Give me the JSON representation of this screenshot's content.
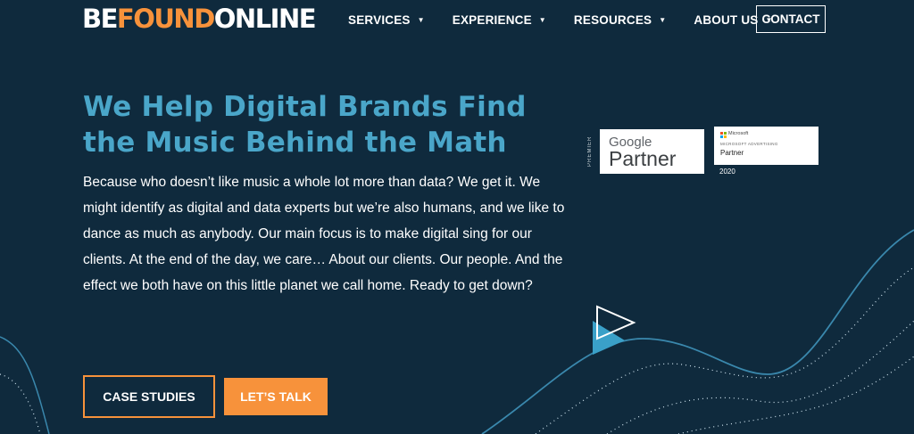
{
  "header": {
    "logo": {
      "part1": "BE",
      "part2": "FOUND",
      "part3": "ONLINE"
    },
    "nav": [
      {
        "label": "SERVICES",
        "icon": "caret-down-icon"
      },
      {
        "label": "EXPERIENCE",
        "icon": "caret-down-icon"
      },
      {
        "label": "RESOURCES",
        "icon": "caret-down-icon"
      },
      {
        "label": "ABOUT US",
        "icon": "caret-down-icon"
      }
    ],
    "contact_label": "CONTACT",
    "caret_glyph": "▼"
  },
  "hero": {
    "title_line1": "We Help Digital Brands Find",
    "title_line2": "the Music Behind the Math",
    "body": "Because who doesn’t like music a whole lot more than data? We get it. We might identify as digital and data experts but we’re also humans, and we like to dance as much as anybody. Our main focus is to make digital sing for our clients. At the end of the day, we care… About our clients. Our people. And the effect we both have on this little planet we call home. Ready to get down?"
  },
  "badges": {
    "google": {
      "premier": "PREMIER",
      "label": "Google",
      "partner": "Partner"
    },
    "microsoft": {
      "brand": "Microsoft",
      "program": "MICROSOFT ADVERTISING",
      "partner": "Partner",
      "year": "2020"
    }
  },
  "buttons": {
    "case_studies": "CASE STUDIES",
    "lets_talk": "LET’S TALK"
  },
  "colors": {
    "background": "#0f2a3d",
    "accent_orange": "#f7923b",
    "title_blue": "#4aa6c9",
    "wave_blue": "#3a88ad"
  }
}
